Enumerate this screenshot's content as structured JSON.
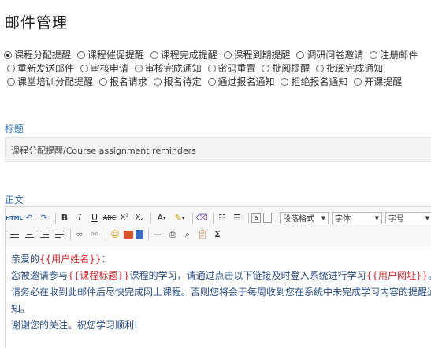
{
  "page": {
    "title": "邮件管理"
  },
  "templates": [
    {
      "label": "课程分配提醒",
      "checked": true
    },
    {
      "label": "课程催促提醒",
      "checked": false
    },
    {
      "label": "课程完成提醒",
      "checked": false
    },
    {
      "label": "课程到期提醒",
      "checked": false
    },
    {
      "label": "调研问卷邀请",
      "checked": false
    },
    {
      "label": "注册邮件",
      "checked": false
    },
    {
      "label": "重新发送邮件",
      "checked": false
    },
    {
      "label": "审核申请",
      "checked": false
    },
    {
      "label": "审核完成通知",
      "checked": false
    },
    {
      "label": "密码重置",
      "checked": false
    },
    {
      "label": "批阅提醒",
      "checked": false
    },
    {
      "label": "批阅完成通知",
      "checked": false
    },
    {
      "label": "课堂培训分配提醒",
      "checked": false
    },
    {
      "label": "报名请求",
      "checked": false
    },
    {
      "label": "报名待定",
      "checked": false
    },
    {
      "label": "通过报名通知",
      "checked": false
    },
    {
      "label": "拒绝报名通知",
      "checked": false
    },
    {
      "label": "开课提醒",
      "checked": false
    }
  ],
  "subject": {
    "label": "标题",
    "value": "课程分配提醒/Course assignment reminders"
  },
  "body": {
    "label": "正文",
    "toolbar": {
      "html_label": "HTML",
      "paragraph_format": "段落格式",
      "font_family": "字体",
      "font_size": "字号",
      "sigma": "Σ",
      "superscript": "X²",
      "subscript": "X₂",
      "font_color": "A",
      "bold": "B",
      "italic": "I",
      "underline": "U",
      "strike": "ABC"
    },
    "content": {
      "line1_prefix": "亲爱的",
      "line1_placeholder": "{{用户姓名}}",
      "line1_suffix": "：",
      "line2_prefix": "您被邀请参与",
      "line2_placeholder1": "{{课程标题}}",
      "line2_middle": "课程的学习，请通过点击以下链接及时登入系统进行学习",
      "line2_placeholder2": "{{用户网址}}",
      "line2_suffix": "。",
      "line3": "请务必在收到此邮件后尽快完成网上课程。否则您将会于每周收到您在系统中未完成学习内容的提醒通知。",
      "line4": "谢谢您的关注。祝您学习顺利!"
    }
  },
  "colors": {
    "label_blue": "#2a6db5",
    "placeholder_red": "#d9282e",
    "body_text": "#2a4f8a"
  }
}
